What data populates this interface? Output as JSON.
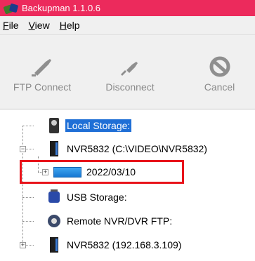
{
  "window": {
    "title": "Backupman 1.1.0.6"
  },
  "menu": [
    {
      "label": "File",
      "accel": "F",
      "rest": "ile"
    },
    {
      "label": "View",
      "accel": "V",
      "rest": "iew"
    },
    {
      "label": "Help",
      "accel": "H",
      "rest": "elp"
    }
  ],
  "toolbar": {
    "ftp_connect": "FTP Connect",
    "disconnect": "Disconnect",
    "cancel": "Cancel"
  },
  "tree": {
    "local_storage": "Local Storage:",
    "nvr_local": "NVR5832 (C:\\VIDEO\\NVR5832)",
    "date_folder": "2022/03/10",
    "usb_storage": "USB Storage:",
    "remote_ftp": "Remote NVR/DVR FTP:",
    "nvr_remote": "NVR5832 (192.168.3.109)"
  },
  "colors": {
    "titlebar": "#ec2a5c",
    "selection": "#1f6fd6",
    "highlight_box": "#e8141b"
  }
}
